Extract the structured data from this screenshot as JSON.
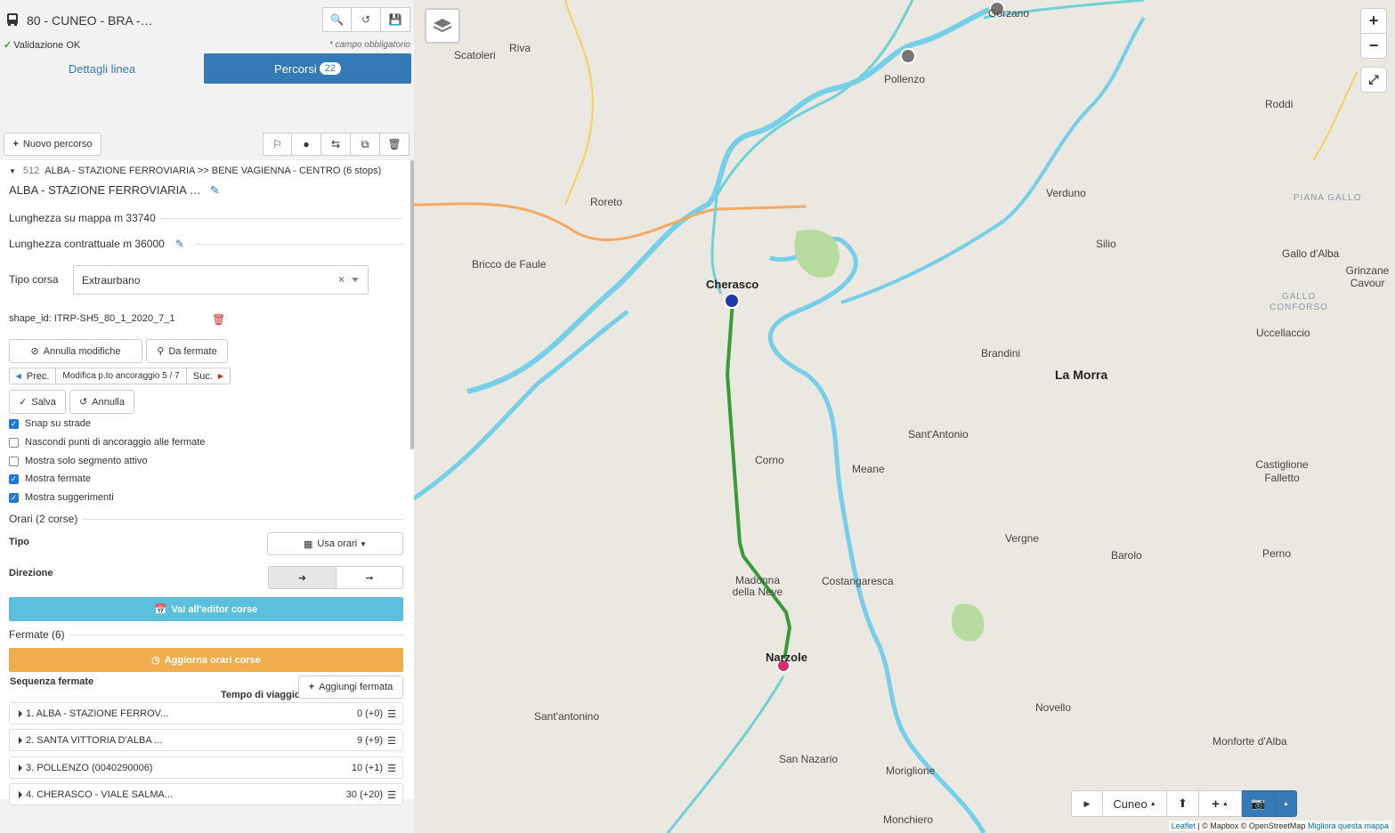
{
  "header": {
    "title": "80 - CUNEO - BRA -…",
    "validation": "Validazione OK",
    "required_note": "* campo obbligatorio",
    "tab_details": "Dettagli linea",
    "tab_routes": "Percorsi",
    "routes_count": "22"
  },
  "toolbar": {
    "new_route": "Nuovo percorso"
  },
  "route": {
    "header_id": "512",
    "header_text": "ALBA - STAZIONE FERROVIARIA >> BENE VAGIENNA - CENTRO (6 stops)",
    "name": "ALBA - STAZIONE FERROVIARIA …",
    "map_length": "Lunghezza su mappa m 33740",
    "contract_length": "Lunghezza contrattuale m 36000",
    "trip_type_label": "Tipo corsa",
    "trip_type_value": "Extraurbano",
    "shape_id": "shape_id: ITRP-SH5_80_1_2020_7_1",
    "cancel_changes": "Annulla modifiche",
    "from_stops": "Da fermate",
    "prev": "Prec.",
    "anchor_edit": "Modifica p.to ancoraggio 5 / 7",
    "next": "Suc.",
    "save": "Salva",
    "cancel": "Annulla"
  },
  "options": [
    {
      "label": "Snap su strade",
      "checked": true
    },
    {
      "label": "Nascondi punti di ancoraggio alle fermate",
      "checked": false
    },
    {
      "label": "Mostra solo segmento attivo",
      "checked": false
    },
    {
      "label": "Mostra fermate",
      "checked": true
    },
    {
      "label": "Mostra suggerimenti",
      "checked": true
    }
  ],
  "schedule": {
    "section": "Orari (2 corse)",
    "type_label": "Tipo",
    "type_value": "Usa orari",
    "direction_label": "Direzione",
    "editor_button": "Vai all'editor corse"
  },
  "stops": {
    "section": "Fermate (6)",
    "update_button": "Aggiorna orari corse",
    "sequence_label": "Sequenza fermate",
    "travel_time_label": "Tempo di viaggio",
    "add_stop": "Aggiungi fermata",
    "items": [
      {
        "name": "1. ALBA - STAZIONE FERROV...",
        "time": "0 (+0)"
      },
      {
        "name": "2. SANTA VITTORIA D'ALBA ...",
        "time": "9 (+9)"
      },
      {
        "name": "3. POLLENZO (0040290006)",
        "time": "10 (+1)"
      },
      {
        "name": "4. CHERASCO - VIALE SALMA...",
        "time": "30 (+20)"
      }
    ]
  },
  "map": {
    "zoom_in": "+",
    "zoom_out": "−",
    "region": "Cuneo",
    "attribution_leaflet": "Leaflet",
    "attribution_rest": " | © Mapbox © OpenStreetMap ",
    "attribution_improve": "Migliora questa mappa",
    "labels": [
      {
        "text": "Cherasco"
      },
      {
        "text": "Narzole"
      },
      {
        "text": "La Morra"
      },
      {
        "text": "Pollenzo"
      },
      {
        "text": "Roreto"
      },
      {
        "text": "Bricco de Faule"
      },
      {
        "text": "Scatoleri"
      },
      {
        "text": "Riva"
      },
      {
        "text": "Verduno"
      },
      {
        "text": "Roddi"
      },
      {
        "text": "Silio"
      },
      {
        "text": "Gallo d'Alba"
      },
      {
        "text": "Grinzane Cavour"
      },
      {
        "text": "Brandini"
      },
      {
        "text": "Uccellaccio"
      },
      {
        "text": "Sant'Antonio"
      },
      {
        "text": "Corno"
      },
      {
        "text": "Meane"
      },
      {
        "text": "Castiglione Falletto"
      },
      {
        "text": "Vergne"
      },
      {
        "text": "Barolo"
      },
      {
        "text": "Perno"
      },
      {
        "text": "Madonna della Neve"
      },
      {
        "text": "Costangaresca"
      },
      {
        "text": "Novello"
      },
      {
        "text": "Monforte d'Alba"
      },
      {
        "text": "San Nazario"
      },
      {
        "text": "Moriglione"
      },
      {
        "text": "Sant'antonino"
      },
      {
        "text": "Monchiero"
      },
      {
        "text": "PIANA GALLO"
      },
      {
        "text": "GALLO CONFORSO"
      },
      {
        "text": "Gorzano"
      }
    ]
  }
}
